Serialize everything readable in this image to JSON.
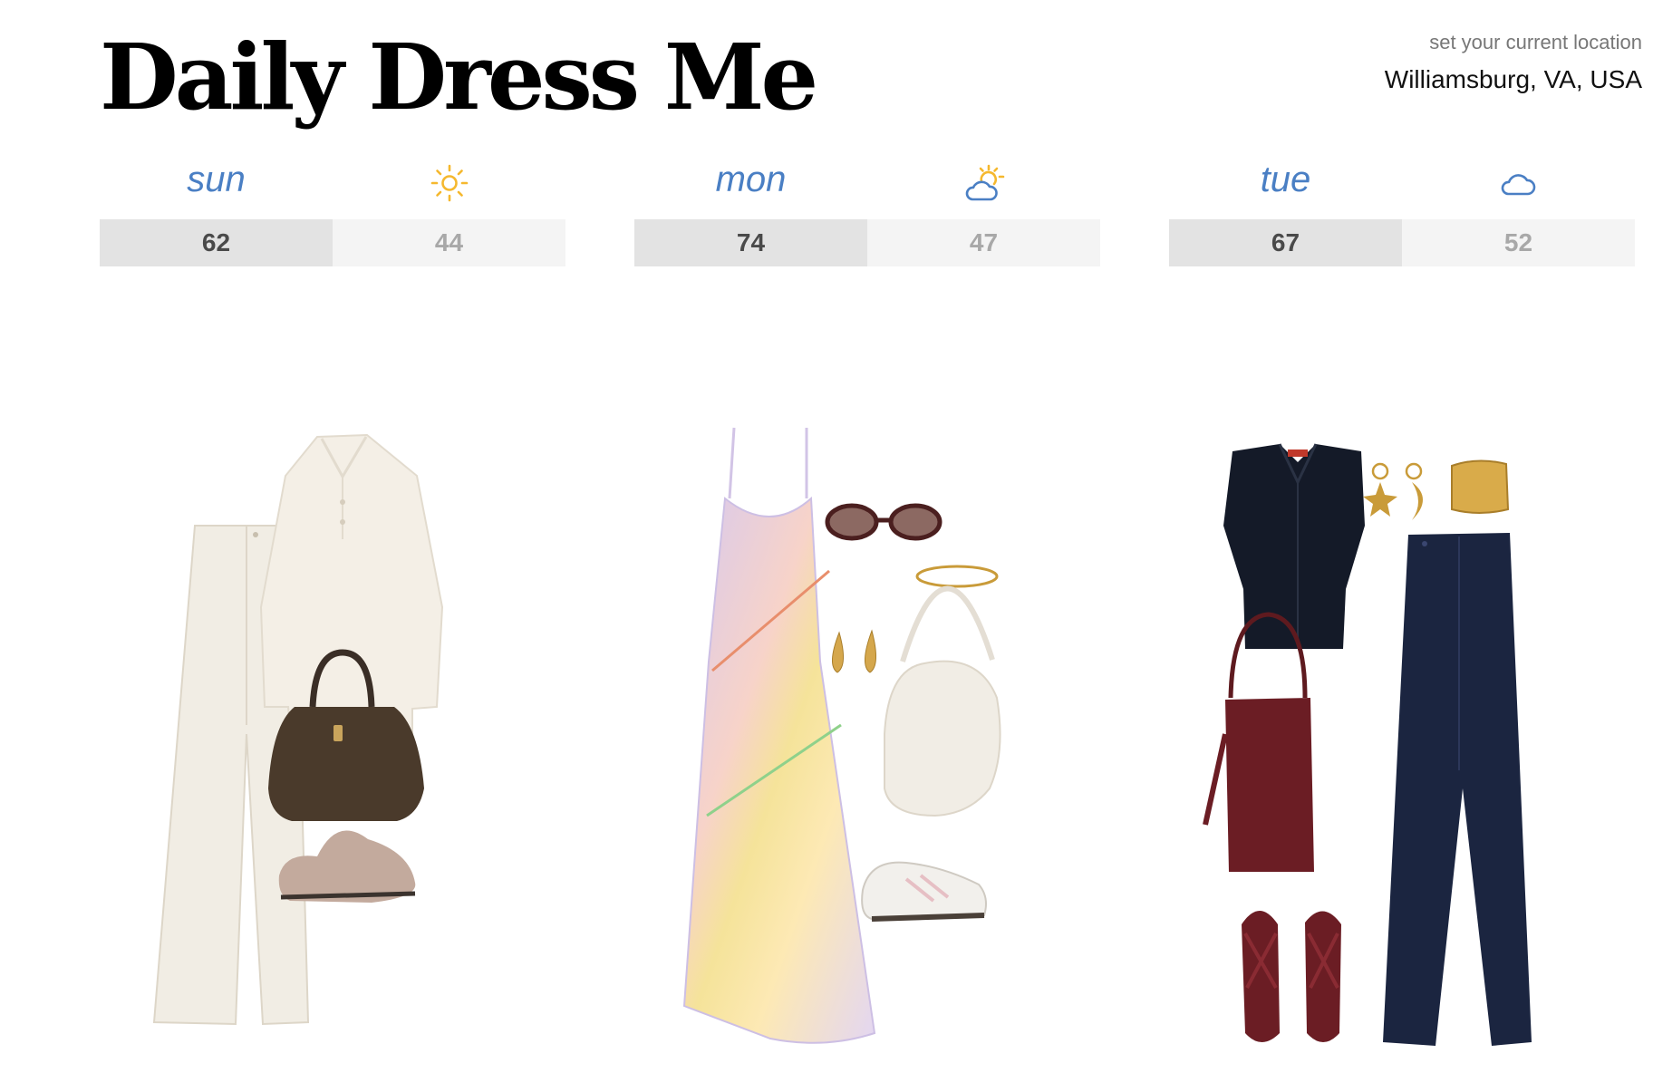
{
  "header": {
    "title": "Daily Dress Me",
    "location_hint": "set your current location",
    "location_value": "Williamsburg, VA, USA"
  },
  "colors": {
    "day_name": "#4a7fc4",
    "sun": "#f5b82e",
    "cloud": "#4a7fc4",
    "temp_high_bg": "#e3e3e3",
    "temp_low_bg": "#f4f4f4"
  },
  "days": [
    {
      "name": "sun",
      "icon": "sun-icon",
      "high": "62",
      "low": "44",
      "outfit": [
        "cream-wide-leg-jeans",
        "cream-knit-polo-sweater",
        "brown-shearling-tote",
        "suede-loafer-mules"
      ]
    },
    {
      "name": "mon",
      "icon": "partly-cloudy-icon",
      "high": "74",
      "low": "47",
      "outfit": [
        "pastel-gingham-slip-dress",
        "burgundy-oval-sunglasses",
        "gold-ring",
        "gold-drop-earrings",
        "white-shoulder-bag",
        "white-sneakers"
      ]
    },
    {
      "name": "tue",
      "icon": "cloud-icon",
      "high": "67",
      "low": "52",
      "outfit": [
        "navy-sleeveless-knit-top",
        "gold-charm-earrings",
        "gold-cuff",
        "navy-wide-leg-trousers",
        "burgundy-bucket-bag",
        "burgundy-strappy-sandals"
      ]
    }
  ]
}
